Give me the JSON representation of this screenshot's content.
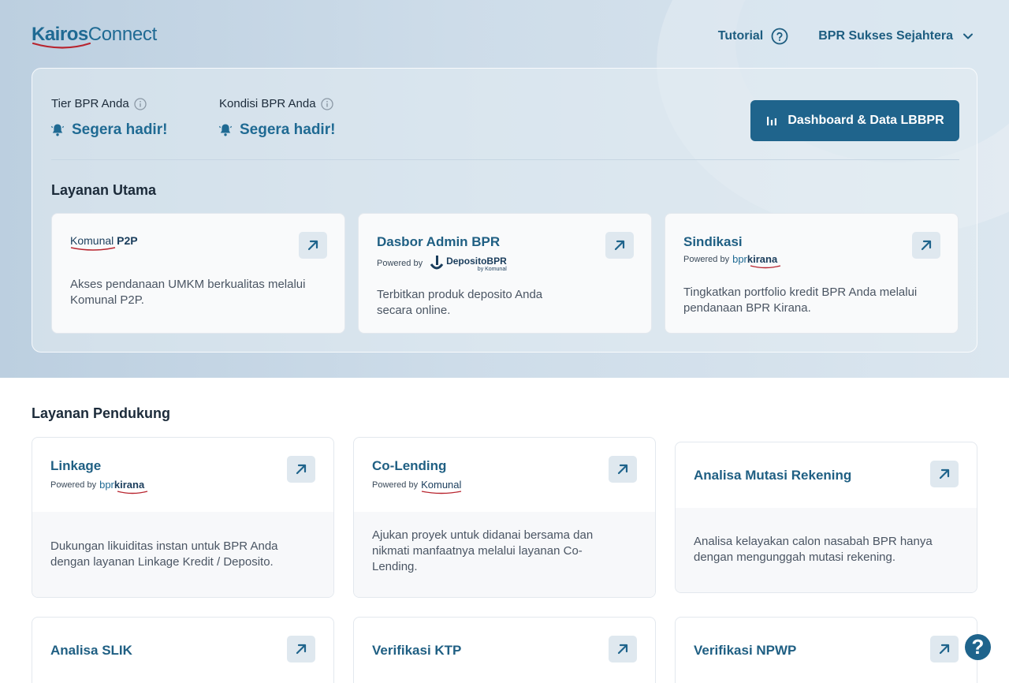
{
  "header": {
    "logo_bold": "Kairos",
    "logo_light": "Connect",
    "tutorial_label": "Tutorial",
    "bpr_name": "BPR Sukses Sejahtera"
  },
  "status": {
    "tier_label": "Tier BPR Anda",
    "tier_value": "Segera hadir!",
    "kondisi_label": "Kondisi BPR Anda",
    "kondisi_value": "Segera hadir!"
  },
  "dashboard_button": "Dashboard & Data LBBPR",
  "main_section": {
    "title": "Layanan Utama",
    "cards": [
      {
        "logo_text_1": "Komunal",
        "logo_text_2": "P2P",
        "description": "Akses pendanaan UMKM berkualitas melalui Komunal P2P."
      },
      {
        "title": "Dasbor Admin BPR",
        "powered_by": "Powered by",
        "partner": "DepositoBPR",
        "partner_sub": "by Komunal",
        "description": "Terbitkan produk deposito Anda secara online."
      },
      {
        "title": "Sindikasi",
        "powered_by": "Powered by",
        "partner_1": "bpr",
        "partner_2": "kirana",
        "description": "Tingkatkan portfolio kredit BPR Anda melalui pendanaan BPR Kirana."
      }
    ]
  },
  "support_section": {
    "title": "Layanan Pendukung",
    "cards": [
      {
        "title": "Linkage",
        "powered_by": "Powered by",
        "partner_1": "bpr",
        "partner_2": "kirana",
        "description": "Dukungan likuiditas instan untuk BPR Anda dengan layanan Linkage Kredit / Deposito."
      },
      {
        "title": "Co-Lending",
        "powered_by": "Powered by",
        "partner": "Komunal",
        "description": "Ajukan proyek untuk didanai bersama dan nikmati manfaatnya melalui layanan Co-Lending."
      },
      {
        "title": "Analisa Mutasi Rekening",
        "description": "Analisa kelayakan calon nasabah BPR hanya dengan mengunggah mutasi rekening."
      },
      {
        "title": "Analisa SLIK"
      },
      {
        "title": "Verifikasi KTP"
      },
      {
        "title": "Verifikasi NPWP"
      }
    ]
  },
  "help_label": "?",
  "colors": {
    "primary": "#1f648c",
    "title_blue": "#1f5f83",
    "accent_red": "#b8252f"
  }
}
